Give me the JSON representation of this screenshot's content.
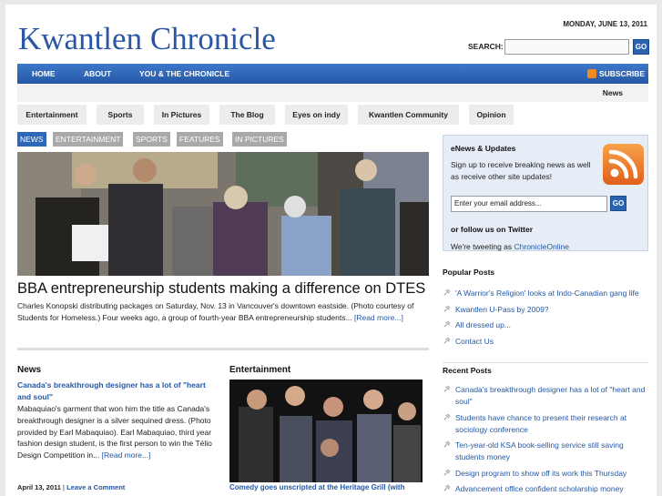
{
  "header": {
    "site_title": "Kwantlen Chronicle",
    "date": "MONDAY, JUNE 13, 2011",
    "search_label": "SEARCH:",
    "search_value": "",
    "search_go": "GO"
  },
  "nav": {
    "items": [
      "HOME",
      "ABOUT",
      "YOU & THE CHRONICLE"
    ],
    "subscribe": "SUBSCRIBE",
    "sub_item": "News"
  },
  "categories": [
    "Entertainment",
    "Sports",
    "In Pictures",
    "The Blog",
    "Eyes on indy",
    "Kwantlen Community",
    "Opinion"
  ],
  "featured_tabs": [
    "NEWS",
    "ENTERTAINMENT",
    "SPORTS",
    "FEATURES",
    "IN PICTURES"
  ],
  "featured": {
    "headline": "BBA entrepreneurship students making a difference on DTES",
    "excerpt": "Charles Konopski distributing packages on Saturday, Nov. 13 in Vancouver's downtown eastside. (Photo courtesy of Students for Homeless.) Four weeks ago, a group of fourth-year BBA entrepreneurship students...",
    "read_more": "[Read more...]"
  },
  "news": {
    "section_title": "News",
    "post_title": "Canada's breakthrough designer has a lot of \"heart and soul\"",
    "post_body": "Mabaquiao's garment that won him the title as Canada's breakthrough designer is a silver sequined dress. (Photo provided by Earl Mabaquiao). Earl Mabaquiao, third year fashion design student, is the first person to win the Télio Design Competition in...",
    "read_more": "[Read more...]",
    "meta_date": "April 13, 2011",
    "meta_sep": " | ",
    "meta_comment": "Leave a Comment"
  },
  "entertainment": {
    "section_title": "Entertainment",
    "caption": "Comedy goes unscripted at the Heritage Grill (with"
  },
  "sidebar": {
    "enews_title": "eNews & Updates",
    "enews_text": "Sign up to receive breaking news as well as receive other site updates!",
    "email_placeholder": "Enter your email address...",
    "email_go": "GO",
    "twitter_title": "or follow us on Twitter",
    "twitter_prefix": "We're tweeting as ",
    "twitter_handle": "ChronicleOnline",
    "popular_title": "Popular Posts",
    "popular": [
      "'A Warrior's Religion' looks at Indo-Canadian gang life",
      "Kwantlen U-Pass by 2009?",
      "All dressed up...",
      "Contact Us"
    ],
    "recent_title": "Recent Posts",
    "recent": [
      "Canada's breakthrough designer has a lot of \"heart and soul\"",
      "Students have chance to present their research at sociology conference",
      "Ten-year-old KSA book-selling service still saving students money",
      "Design program to show off its work this Thursday",
      "Advancement office confident scholarship money"
    ]
  },
  "colors": {
    "brand_blue": "#2a56a3",
    "nav_blue": "#2458a6",
    "link_blue": "#2458a6",
    "rss_orange": "#f08a24"
  }
}
